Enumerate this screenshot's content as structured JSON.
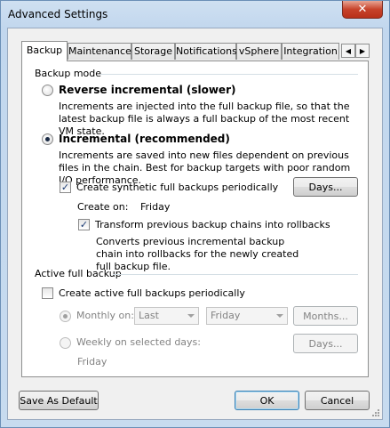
{
  "window": {
    "title": "Advanced Settings",
    "close_glyph": "✕"
  },
  "tabs": [
    {
      "label": "Backup",
      "active": true
    },
    {
      "label": "Maintenance",
      "active": false
    },
    {
      "label": "Storage",
      "active": false
    },
    {
      "label": "Notifications",
      "active": false
    },
    {
      "label": "vSphere",
      "active": false
    },
    {
      "label": "Integration",
      "active": false
    }
  ],
  "tab_scroll": {
    "left": "◀",
    "right": "▶"
  },
  "backup_mode": {
    "group_label": "Backup mode",
    "reverse": {
      "label": "Reverse incremental (slower)",
      "checked": false,
      "description": "Increments are injected into the full backup file, so that the latest backup file is always a full backup of the most recent VM state."
    },
    "incremental": {
      "label": "Incremental (recommended)",
      "checked": true,
      "description": "Increments are saved into new files dependent on previous files in the chain. Best for backup targets with poor random I/O performance."
    },
    "synthetic": {
      "label": "Create synthetic full backups periodically",
      "checked": true,
      "days_button": "Days...",
      "create_on_label": "Create on:",
      "create_on_value": "Friday"
    },
    "transform": {
      "label": "Transform previous backup chains into rollbacks",
      "checked": true,
      "description": "Converts previous incremental backup chain into rollbacks for the newly created full backup file."
    }
  },
  "active_full": {
    "group_label": "Active full backup",
    "create": {
      "label": "Create active full backups periodically",
      "checked": false
    },
    "monthly": {
      "label": "Monthly on:",
      "checked": true,
      "week_select": "Last",
      "day_select": "Friday",
      "months_button": "Months..."
    },
    "weekly": {
      "label": "Weekly on selected days:",
      "checked": false,
      "days_button": "Days...",
      "days_value": "Friday"
    }
  },
  "footer": {
    "save_default": "Save As Default",
    "ok": "OK",
    "cancel": "Cancel"
  },
  "check_glyph": "✓"
}
